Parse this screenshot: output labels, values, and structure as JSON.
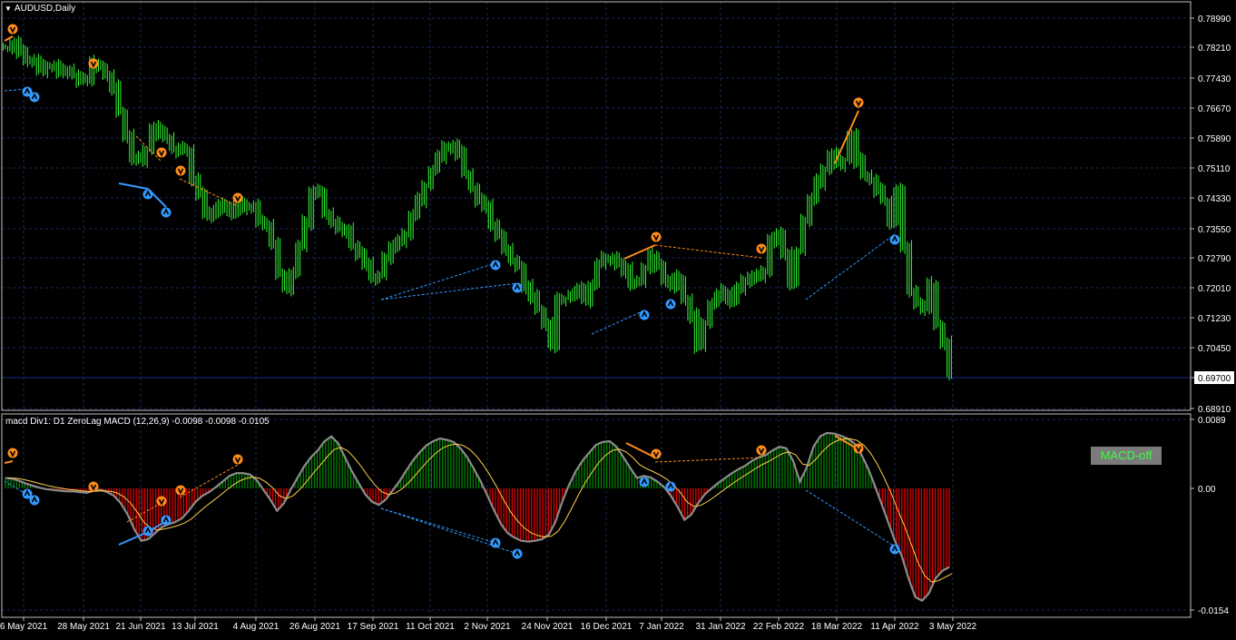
{
  "window": {
    "symbol": "AUDUSD,Daily",
    "indicator_label": "macd Div1: D1 ZeroLag MACD (12,26,9) -0.0098 -0.0098 -0.0105",
    "macd_button": "MACD-off",
    "current_price_label": "0.69700"
  },
  "colors": {
    "background": "#000000",
    "grid": "#1a2a5a",
    "frame": "#c0c0c0",
    "bull_bar": "#33ff33",
    "hist_pos": "#008000",
    "hist_neg": "#e00000",
    "macd_line": "#8c8c8c",
    "signal_line": "#ffd24a",
    "bear_div": "#ff8c1a",
    "bull_div": "#3399ff",
    "price_line": "#1a2a8c"
  },
  "price_axis": [
    "0.78990",
    "0.78210",
    "0.77430",
    "0.76670",
    "0.75890",
    "0.75110",
    "0.74330",
    "0.73550",
    "0.72790",
    "0.72010",
    "0.71230",
    "0.70450",
    "0.69700",
    "0.68910"
  ],
  "macd_axis": [
    "0.0089",
    "0.00",
    "-0.0154"
  ],
  "time_axis": [
    "6 May 2021",
    "28 May 2021",
    "21 Jun 2021",
    "13 Jul 2021",
    "4 Aug 2021",
    "26 Aug 2021",
    "17 Sep 2021",
    "11 Oct 2021",
    "2 Nov 2021",
    "24 Nov 2021",
    "16 Dec 2021",
    "7 Jan 2022",
    "31 Jan 2022",
    "22 Feb 2022",
    "18 Mar 2022",
    "11 Apr 2022",
    "3 May 2022"
  ],
  "chart_data": {
    "type": "line",
    "series": [
      {
        "name": "AUDUSD",
        "values": [
          0.7805,
          0.7815,
          0.779,
          0.7775,
          0.777,
          0.7745,
          0.7755,
          0.776,
          0.7745,
          0.774,
          0.7735,
          0.772,
          0.7725,
          0.7765,
          0.7755,
          0.773,
          0.77,
          0.764,
          0.758,
          0.752,
          0.7515,
          0.7545,
          0.76,
          0.7585,
          0.7575,
          0.7545,
          0.754,
          0.7545,
          0.747,
          0.743,
          0.7375,
          0.738,
          0.7405,
          0.7395,
          0.738,
          0.741,
          0.7395,
          0.7395,
          0.7365,
          0.735,
          0.73,
          0.723,
          0.719,
          0.723,
          0.7295,
          0.7355,
          0.744,
          0.743,
          0.7385,
          0.736,
          0.734,
          0.7335,
          0.73,
          0.728,
          0.725,
          0.7215,
          0.7225,
          0.727,
          0.7295,
          0.7305,
          0.733,
          0.7375,
          0.7415,
          0.7455,
          0.749,
          0.7525,
          0.7545,
          0.7555,
          0.7535,
          0.7485,
          0.7445,
          0.7415,
          0.7395,
          0.7355,
          0.7325,
          0.7285,
          0.7265,
          0.7245,
          0.7195,
          0.7165,
          0.7135,
          0.71,
          0.7045,
          0.716,
          0.7165,
          0.7175,
          0.7185,
          0.716,
          0.72,
          0.725,
          0.7265,
          0.727,
          0.725,
          0.7235,
          0.72,
          0.721,
          0.724,
          0.7275,
          0.725,
          0.721,
          0.7195,
          0.7215,
          0.716,
          0.712,
          0.704,
          0.7105,
          0.715,
          0.717,
          0.718,
          0.7155,
          0.719,
          0.7205,
          0.7225,
          0.722,
          0.723,
          0.731,
          0.733,
          0.7275,
          0.7205,
          0.7285,
          0.7365,
          0.7415,
          0.746,
          0.7495,
          0.753,
          0.7505,
          0.752,
          0.758,
          0.7515,
          0.748,
          0.7465,
          0.744,
          0.7415,
          0.736,
          0.744,
          0.729,
          0.7185,
          0.715,
          0.714,
          0.72,
          0.7095,
          0.705,
          0.697
        ]
      }
    ],
    "macd": [
      0.0015,
      0.0014,
      0.0011,
      0.0007,
      0.0004,
      0.0001,
      -0.0001,
      -0.0002,
      -0.0003,
      -0.0004,
      -0.0004,
      -0.0005,
      -0.0006,
      -0.0003,
      -0.0002,
      -0.0005,
      -0.001,
      -0.002,
      -0.0035,
      -0.0055,
      -0.007,
      -0.0068,
      -0.006,
      -0.0052,
      -0.0048,
      -0.0045,
      -0.004,
      -0.003,
      -0.0018,
      -0.001,
      -0.0005,
      0.0002,
      0.001,
      0.0018,
      0.0022,
      0.0022,
      0.002,
      0.0012,
      -0.0002,
      -0.0015,
      -0.003,
      -0.002,
      -0.0002,
      0.0015,
      0.0032,
      0.0045,
      0.0055,
      0.0068,
      0.0075,
      0.0065,
      0.0045,
      0.0025,
      0.0008,
      -0.0008,
      -0.0018,
      -0.0022,
      -0.0015,
      -0.0003,
      0.001,
      0.0025,
      0.004,
      0.0052,
      0.0062,
      0.0068,
      0.0072,
      0.007,
      0.0067,
      0.0058,
      0.0045,
      0.0028,
      0.001,
      -0.001,
      -0.003,
      -0.0048,
      -0.006,
      -0.0066,
      -0.007,
      -0.0071,
      -0.007,
      -0.0068,
      -0.0062,
      -0.0045,
      -0.0018,
      0.0005,
      0.0025,
      0.004,
      0.0052,
      0.0063,
      0.0067,
      0.0068,
      0.006,
      0.0045,
      0.003,
      0.0015,
      0.0018,
      0.0016,
      0.001,
      0.0002,
      -0.001,
      -0.0025,
      -0.0042,
      -0.0035,
      -0.002,
      -0.0008,
      0.0,
      0.0008,
      0.0015,
      0.0022,
      0.0028,
      0.0033,
      0.004,
      0.0045,
      0.0048,
      0.0055,
      0.006,
      0.0058,
      0.004,
      0.001,
      0.003,
      0.006,
      0.0075,
      0.008,
      0.0079,
      0.0076,
      0.0072,
      0.0065,
      0.005,
      0.003,
      0.0005,
      -0.002,
      -0.0045,
      -0.007,
      -0.009,
      -0.012,
      -0.0145,
      -0.015,
      -0.014,
      -0.012,
      -0.011,
      -0.0105
    ],
    "macd_range": [
      -0.0154,
      0.0089
    ],
    "price_range": [
      0.6891,
      0.791
    ]
  }
}
